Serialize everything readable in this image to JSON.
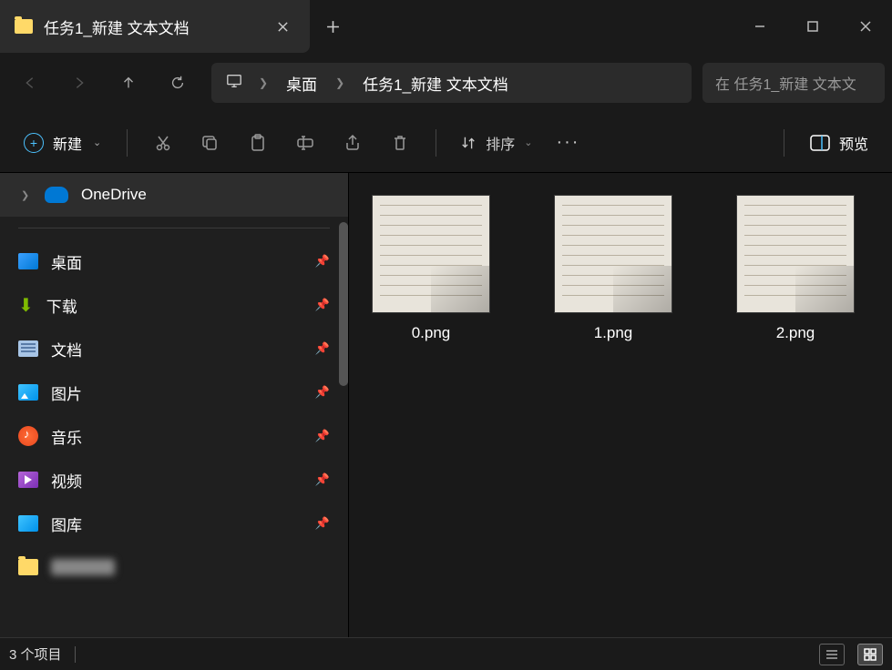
{
  "tab": {
    "title": "任务1_新建 文本文档"
  },
  "breadcrumb": {
    "items": [
      "桌面",
      "任务1_新建 文本文档"
    ]
  },
  "search": {
    "placeholder": "在 任务1_新建 文本文"
  },
  "toolbar": {
    "new_label": "新建",
    "sort_label": "排序",
    "preview_label": "预览"
  },
  "sidebar": {
    "onedrive": "OneDrive",
    "items": [
      {
        "label": "桌面"
      },
      {
        "label": "下载"
      },
      {
        "label": "文档"
      },
      {
        "label": "图片"
      },
      {
        "label": "音乐"
      },
      {
        "label": "视频"
      },
      {
        "label": "图库"
      }
    ]
  },
  "files": [
    {
      "name": "0.png"
    },
    {
      "name": "1.png"
    },
    {
      "name": "2.png"
    }
  ],
  "status": {
    "count": "3 个项目"
  }
}
